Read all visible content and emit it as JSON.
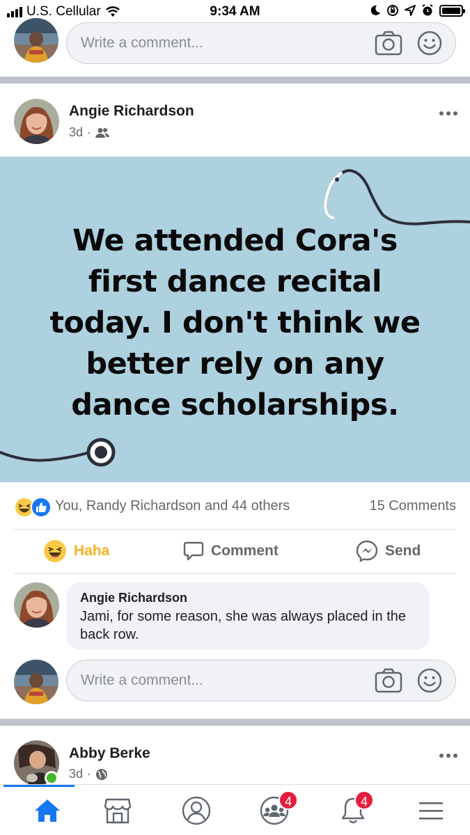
{
  "status_bar": {
    "carrier": "U.S. Cellular",
    "time": "9:34 AM"
  },
  "top_comment_composer": {
    "placeholder": "Write a comment..."
  },
  "post": {
    "author": "Angie Richardson",
    "time": "3d",
    "audience_icon": "friends-icon",
    "image_text": "We attended Cora's first dance recital today. I don't think we better rely on any dance scholarships.",
    "image_background": "#aed1e0",
    "reactions_summary": "You, Randy Richardson and 44 others",
    "reaction_icons": [
      "haha-icon",
      "like-icon"
    ],
    "comments_count": "15 Comments",
    "actions": {
      "haha": "Haha",
      "comment": "Comment",
      "send": "Send"
    },
    "comment": {
      "author": "Angie Richardson",
      "text": "Jami, for some reason, she was always placed in the back row."
    },
    "composer_placeholder": "Write a comment..."
  },
  "next_post": {
    "author": "Abby Berke",
    "time": "3d",
    "audience_icon": "globe-icon"
  },
  "tab_bar": {
    "tabs": [
      {
        "name": "home",
        "icon": "home-icon",
        "active": true
      },
      {
        "name": "marketplace",
        "icon": "marketplace-icon"
      },
      {
        "name": "profile",
        "icon": "profile-icon"
      },
      {
        "name": "groups",
        "icon": "groups-icon",
        "badge": "4"
      },
      {
        "name": "notifications",
        "icon": "bell-icon",
        "badge": "4"
      },
      {
        "name": "menu",
        "icon": "menu-icon"
      }
    ]
  },
  "colors": {
    "brand_blue": "#1877f2",
    "haha_yellow": "#f7b125",
    "badge_red": "#e41e3f"
  }
}
